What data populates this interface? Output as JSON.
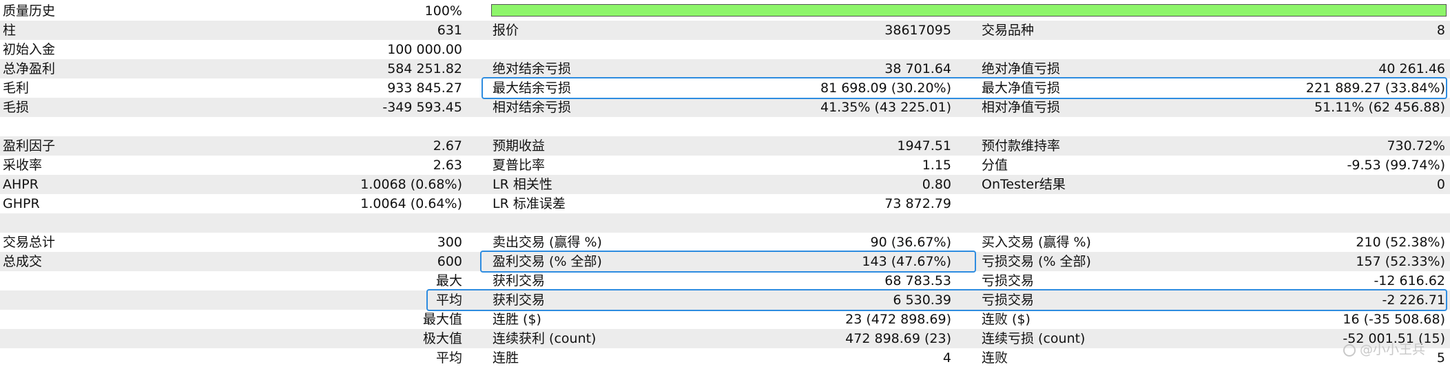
{
  "quality": {
    "label": "质量历史",
    "value": "100%",
    "fraction": 1.0,
    "bar_color": "#8df56a"
  },
  "bars": {
    "label": "柱",
    "value": "631"
  },
  "ticks": {
    "label": "报价",
    "value": "38617095"
  },
  "symbols": {
    "label": "交易品种",
    "value": "8"
  },
  "initial_deposit": {
    "label": "初始入金",
    "value": "100 000.00"
  },
  "net_profit": {
    "label": "总净盈利",
    "value": "584 251.82"
  },
  "balance_dd_abs": {
    "label": "绝对结余亏损",
    "value": "38 701.64"
  },
  "equity_dd_abs": {
    "label": "绝对净值亏损",
    "value": "40 261.46"
  },
  "gross_profit": {
    "label": "毛利",
    "value": "933 845.27"
  },
  "balance_dd_max": {
    "label": "最大结余亏损",
    "value": "81 698.09 (30.20%)"
  },
  "equity_dd_max": {
    "label": "最大净值亏损",
    "value": "221 889.27 (33.84%)"
  },
  "gross_loss": {
    "label": "毛损",
    "value": "-349 593.45"
  },
  "balance_dd_rel": {
    "label": "相对结余亏损",
    "value": "41.35% (43 225.01)"
  },
  "equity_dd_rel": {
    "label": "相对净值亏损",
    "value": "51.11% (62 456.88)"
  },
  "profit_factor": {
    "label": "盈利因子",
    "value": "2.67"
  },
  "expected_payoff": {
    "label": "预期收益",
    "value": "1947.51"
  },
  "margin_level": {
    "label": "预付款维持率",
    "value": "730.72%"
  },
  "recovery_factor": {
    "label": "采收率",
    "value": "2.63"
  },
  "sharpe_ratio": {
    "label": "夏普比率",
    "value": "1.15"
  },
  "z_score": {
    "label": "分值",
    "value": "-9.53 (99.74%)"
  },
  "ahpr": {
    "label": "AHPR",
    "value": "1.0068 (0.68%)"
  },
  "lr_correlation": {
    "label": "LR 相关性",
    "value": "0.80"
  },
  "ontester": {
    "label": "OnTester结果",
    "value": "0"
  },
  "ghpr": {
    "label": "GHPR",
    "value": "1.0064 (0.64%)"
  },
  "lr_std_error": {
    "label": "LR 标准误差",
    "value": "73 872.79"
  },
  "total_trades": {
    "label": "交易总计",
    "value": "300"
  },
  "short_trades": {
    "label": "卖出交易 (赢得 %)",
    "value": "90 (36.67%)"
  },
  "long_trades": {
    "label": "买入交易 (赢得 %)",
    "value": "210 (52.38%)"
  },
  "total_deals": {
    "label": "总成交",
    "value": "600"
  },
  "profit_trades": {
    "label": "盈利交易 (% 全部)",
    "value": "143 (47.67%)"
  },
  "loss_trades": {
    "label": "亏损交易 (% 全部)",
    "value": "157 (52.33%)"
  },
  "largest": {
    "label": "最大",
    "profit_label": "获利交易",
    "profit_value": "68 783.53",
    "loss_label": "亏损交易",
    "loss_value": "-12 616.62"
  },
  "average": {
    "label": "平均",
    "profit_label": "获利交易",
    "profit_value": "6 530.39",
    "loss_label": "亏损交易",
    "loss_value": "-2 226.71"
  },
  "max_consecutive": {
    "label": "最大值",
    "wins_label": "连胜 ($)",
    "wins_value": "23 (472 898.69)",
    "losses_label": "连败 ($)",
    "losses_value": "16 (-35 508.68)"
  },
  "maximal_consecutive": {
    "label": "极大值",
    "profit_label": "连续获利 (count)",
    "profit_value": "472 898.69 (23)",
    "loss_label": "连续亏损 (count)",
    "loss_value": "-52 001.51 (15)"
  },
  "average_consecutive": {
    "label": "平均",
    "wins_label": "连胜",
    "wins_value": "4",
    "losses_label": "连败",
    "losses_value": "5"
  },
  "watermark": {
    "text": "@小小王兵",
    "icon": "watermark-logo-icon"
  },
  "colors": {
    "highlight": "#2d8ce0",
    "row_shade": "#ececec"
  }
}
